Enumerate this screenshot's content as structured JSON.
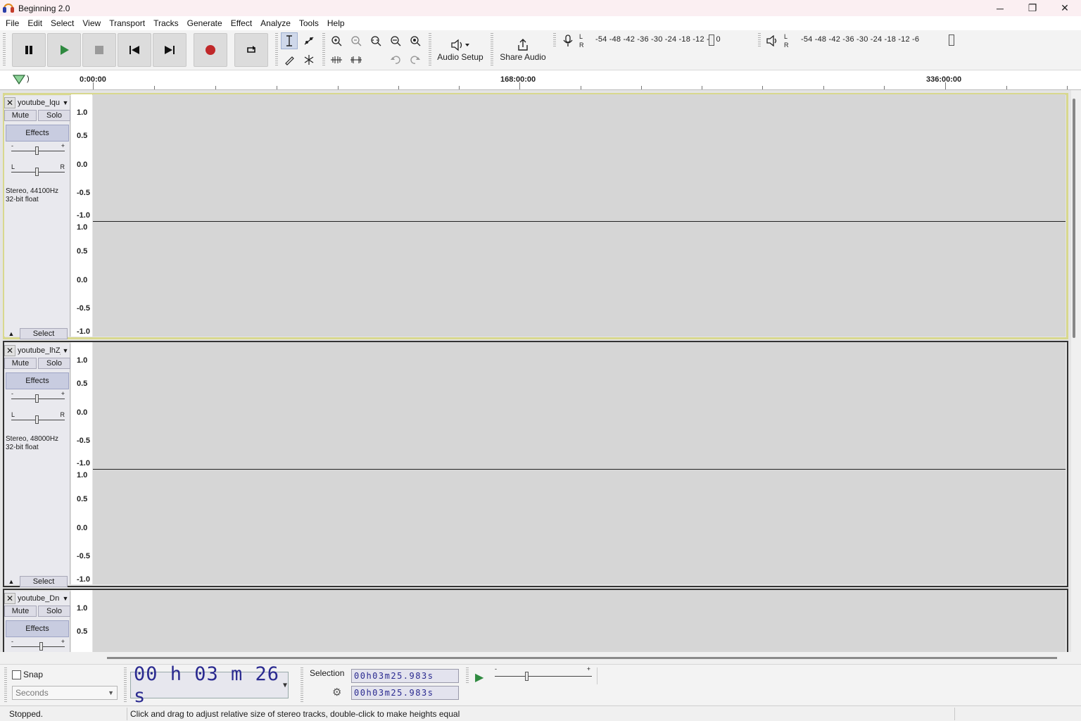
{
  "window": {
    "title": "Beginning 2.0",
    "minimize": "─",
    "maximize": "❐",
    "close": "✕"
  },
  "menu": [
    "File",
    "Edit",
    "Select",
    "View",
    "Transport",
    "Tracks",
    "Generate",
    "Effect",
    "Analyze",
    "Tools",
    "Help"
  ],
  "toolbar": {
    "audio_setup": "Audio Setup",
    "share_audio": "Share Audio",
    "record_meter_scale": "-54 -48 -42 -36 -30 -24 -18 -12  -6  0",
    "playback_meter_scale": "-54 -48 -42 -36 -30 -24 -18 -12  -6",
    "meter_l": "L",
    "meter_r": "R"
  },
  "ruler": {
    "labels": [
      "0:00:00",
      "168:00:00",
      "336:00:00"
    ]
  },
  "tracks": [
    {
      "name": "youtube_lqu",
      "mute": "Mute",
      "solo": "Solo",
      "effects": "Effects",
      "info_line1": "Stereo, 44100Hz",
      "info_line2": "32-bit float",
      "select": "Select",
      "selected": true
    },
    {
      "name": "youtube_lhZj",
      "mute": "Mute",
      "solo": "Solo",
      "effects": "Effects",
      "info_line1": "Stereo, 48000Hz",
      "info_line2": "32-bit float",
      "select": "Select",
      "selected": false
    },
    {
      "name": "youtube_Dn",
      "mute": "Mute",
      "solo": "Solo",
      "effects": "Effects",
      "selected": false
    }
  ],
  "scale_labels": [
    "1.0",
    "0.5",
    "0.0",
    "-0.5",
    "-1.0"
  ],
  "gain_minus": "-",
  "gain_plus": "+",
  "pan_l": "L",
  "pan_r": "R",
  "bottom": {
    "snap_label": "Snap",
    "snap_unit": "Seconds",
    "audio_position": "00 h 03 m 26 s",
    "selection_label": "Selection",
    "selection_start": "00h03m25.983s",
    "selection_end": "00h03m25.983s"
  },
  "status": {
    "state": "Stopped.",
    "message": "Click and drag to adjust relative size of stereo tracks, double-click to make heights equal"
  }
}
